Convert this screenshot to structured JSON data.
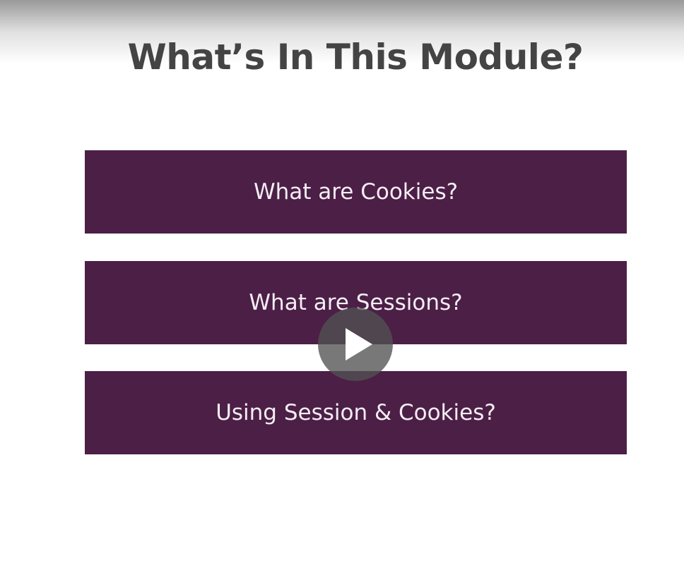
{
  "slide": {
    "title": "What’s In This Module?",
    "items": [
      {
        "label": "What are Cookies?"
      },
      {
        "label": "What are Sessions?"
      },
      {
        "label": "Using Session & Cookies?"
      }
    ]
  },
  "player": {
    "play_icon": "play-icon"
  },
  "colors": {
    "card_bg": "#4c1f47",
    "title_text": "#444444",
    "card_text": "#f4eef3"
  }
}
